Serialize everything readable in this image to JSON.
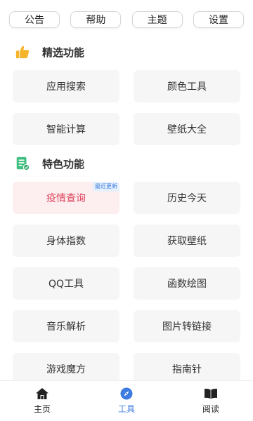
{
  "top_buttons": [
    {
      "label": "公告"
    },
    {
      "label": "帮助"
    },
    {
      "label": "主题"
    },
    {
      "label": "设置"
    }
  ],
  "sections": {
    "featured": {
      "title": "精选功能",
      "icon": "thumbs-up-icon",
      "items": [
        {
          "label": "应用搜索"
        },
        {
          "label": "颜色工具"
        },
        {
          "label": "智能计算"
        },
        {
          "label": "壁纸大全"
        }
      ]
    },
    "special": {
      "title": "特色功能",
      "icon": "document-check-icon",
      "items": [
        {
          "label": "疫情查询",
          "badge": "最近更新"
        },
        {
          "label": "历史今天"
        },
        {
          "label": "身体指数"
        },
        {
          "label": "获取壁纸"
        },
        {
          "label": "QQ工具"
        },
        {
          "label": "函数绘图"
        },
        {
          "label": "音乐解析"
        },
        {
          "label": "图片转链接"
        },
        {
          "label": "游戏魔方"
        },
        {
          "label": "指南针"
        }
      ]
    }
  },
  "bottom_nav": {
    "active": "tools",
    "items": [
      {
        "label": "主页",
        "icon": "home-icon"
      },
      {
        "label": "工具",
        "icon": "compass-icon"
      },
      {
        "label": "阅读",
        "icon": "book-icon"
      }
    ]
  },
  "colors": {
    "accent": "#3d7be0",
    "highlight_text": "#e0455d",
    "highlight_bg": "#fdeef0",
    "card_bg": "#f6f6f6",
    "featured_icon": "#f5b42a",
    "special_icon": "#3fbf7f"
  }
}
